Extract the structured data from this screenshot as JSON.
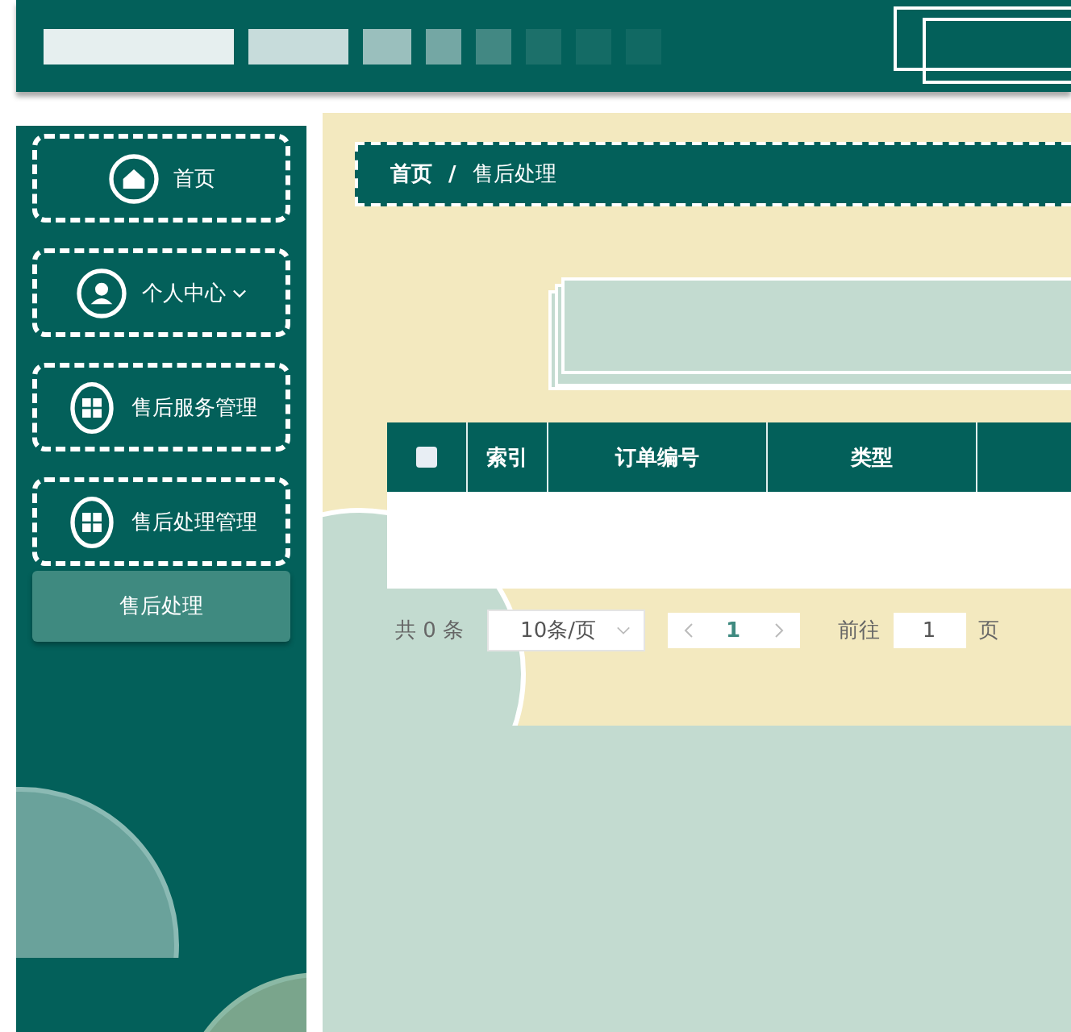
{
  "sidebar": {
    "items": [
      {
        "label": "首页"
      },
      {
        "label": "个人中心",
        "has_caret": true
      },
      {
        "label": "售后服务管理"
      },
      {
        "label": "售后处理管理",
        "children": [
          {
            "label": "售后处理",
            "selected": true
          }
        ]
      }
    ]
  },
  "breadcrumb": {
    "items": [
      "首页",
      "售后处理"
    ],
    "separator": "/"
  },
  "table": {
    "select_all": {
      "checked": false
    },
    "columns": [
      "索引",
      "订单编号",
      "类型"
    ]
  },
  "pagination": {
    "total": "共 0 条",
    "page_size": "10条/页",
    "pages": [
      {
        "label": "1",
        "selected": true
      }
    ],
    "goto_label": "前往",
    "goto_value": "1",
    "page_unit": "页"
  }
}
